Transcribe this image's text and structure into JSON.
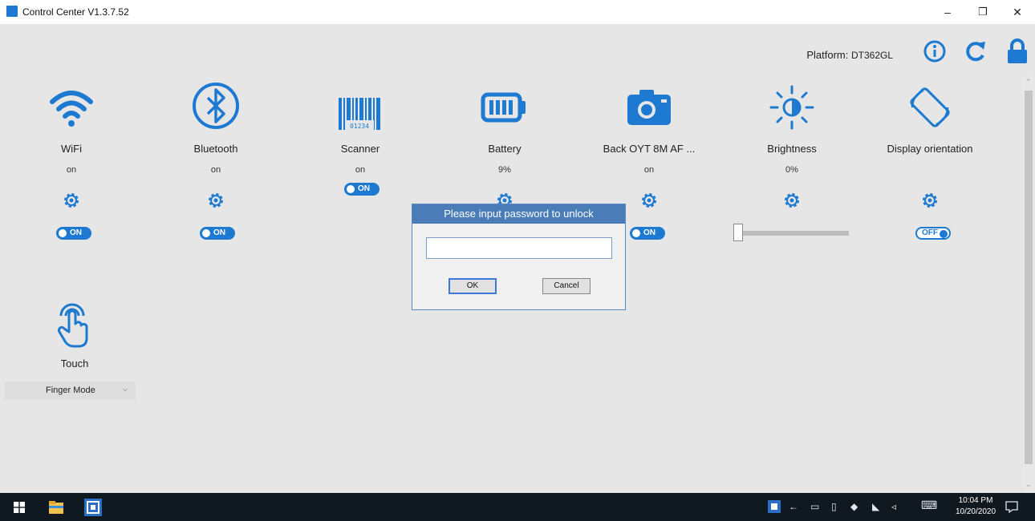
{
  "window": {
    "title": "Control Center V1.3.7.52",
    "minimize": "–",
    "restore": "❐",
    "close": "✕"
  },
  "header": {
    "platform_label": "Platform:",
    "platform_value": "DT362GL",
    "info_icon": "info-icon",
    "refresh_icon": "refresh-icon",
    "lock_icon": "lock-icon"
  },
  "tiles": [
    {
      "label": "WiFi",
      "status": "on",
      "toggle": "ON"
    },
    {
      "label": "Bluetooth",
      "status": "on",
      "toggle": "ON"
    },
    {
      "label": "Scanner",
      "status": "on",
      "toggle": "ON"
    },
    {
      "label": "Battery",
      "status": "9%"
    },
    {
      "label": "Back OYT 8M AF ...",
      "status": "on",
      "toggle": "ON"
    },
    {
      "label": "Brightness",
      "status": "0%",
      "slider_value": 0
    },
    {
      "label": "Display orientation",
      "toggle": "OFF"
    }
  ],
  "scanner_barcode_digits": "01234",
  "touch": {
    "label": "Touch",
    "mode": "Finger Mode"
  },
  "dialog": {
    "title": "Please input password to unlock",
    "password_value": "",
    "ok_label": "OK",
    "cancel_label": "Cancel"
  },
  "taskbar": {
    "time": "10:04 PM",
    "date": "10/20/2020"
  },
  "colors": {
    "accent": "#1e7ad0",
    "dialog_title": "#4a7db8",
    "taskbar": "#101820",
    "background": "#e6e6e6"
  }
}
